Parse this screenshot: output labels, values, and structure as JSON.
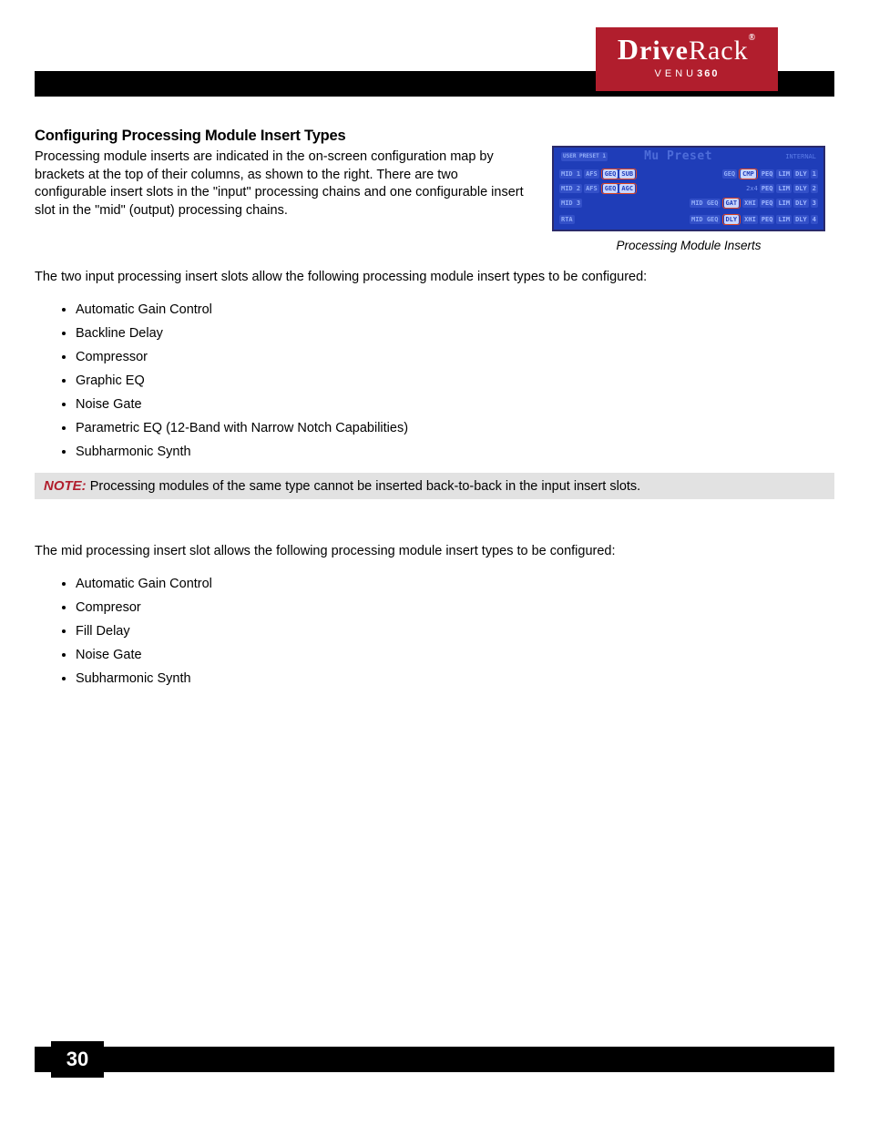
{
  "brand": {
    "logo_text": "DriveRack",
    "model_prefix": "VENU",
    "model_suffix": "360"
  },
  "heading": "Configuring Processing Module Insert Types",
  "intro": "Processing module inserts are indicated in the on-screen configuration map by brackets at the top of their columns, as shown to the right. There are two configurable insert slots in the \"input\" processing chains and one configurable insert slot in the \"mid\" (output) processing chains.",
  "figure": {
    "caption": "Processing Module Inserts",
    "lcd": {
      "preset_label": "USER PRESET 1",
      "preset_name": "Mu Preset",
      "status": "INTERNAL",
      "rows": [
        {
          "left_label": "MID 1",
          "in_chips": [
            "AFS"
          ],
          "in_bracket": [
            "GEQ",
            "SUB"
          ],
          "mid_chip": "GEQ",
          "mid_bracket": [
            "CMP"
          ],
          "out_chips": [
            "PEQ",
            "LIM",
            "DLY"
          ],
          "out_num": "1"
        },
        {
          "left_label": "MID 2",
          "in_chips": [
            "AFS"
          ],
          "in_bracket": [
            "GEQ",
            "AGC"
          ],
          "mid_chip": "",
          "mid_bracket": [],
          "x_label": "2x4",
          "out_chips": [
            "PEQ",
            "LIM",
            "DLY"
          ],
          "out_num": "2"
        },
        {
          "left_label": "MID 3",
          "in_chips": [],
          "in_bracket": [],
          "mid_chip": "MID GEQ",
          "mid_bracket": [
            "GAT"
          ],
          "more": "XHI PEQ LIM DLY",
          "out_num": "3"
        },
        {
          "left_label": "RTA",
          "in_chips": [],
          "in_bracket": [],
          "mid_chip": "MID GEQ",
          "mid_bracket": [
            "DLY"
          ],
          "more": "XHI PEQ LIM DLY",
          "out_num": "4"
        }
      ]
    }
  },
  "input_intro": "The two input processing insert slots allow the following processing module insert types to be configured:",
  "input_list": [
    "Automatic Gain Control",
    "Backline Delay",
    "Compressor",
    "Graphic EQ",
    "Noise Gate",
    "Parametric EQ (12-Band with Narrow Notch Capabilities)",
    "Subharmonic Synth"
  ],
  "note": {
    "label": "NOTE:",
    "text": " Processing modules of the same type cannot be inserted back-to-back in the input insert slots."
  },
  "mid_intro": "The mid processing insert slot allows the following processing module insert types to be configured:",
  "mid_list": [
    "Automatic Gain Control",
    "Compresor",
    "Fill Delay",
    "Noise Gate",
    "Subharmonic Synth"
  ],
  "page_number": "30"
}
